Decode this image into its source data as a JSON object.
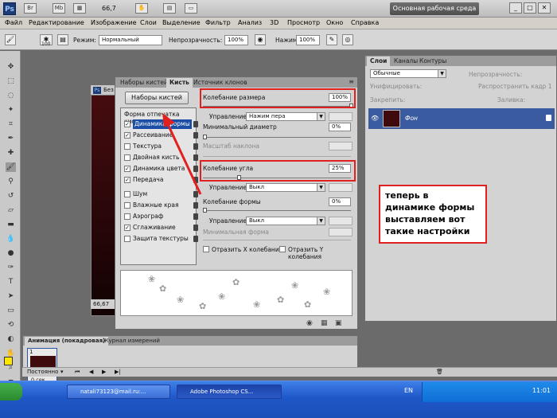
{
  "app": {
    "zoom": "66,7",
    "workspace_button": "Основная рабочая среда"
  },
  "menu": [
    "Файл",
    "Редактирование",
    "Изображение",
    "Слои",
    "Выделение",
    "Фильтр",
    "Анализ",
    "3D",
    "Просмотр",
    "Окно",
    "Справка"
  ],
  "options": {
    "brush_size": "100",
    "mode_label": "Режим:",
    "mode_value": "Нормальный",
    "opacity_label": "Непрозрачность:",
    "opacity_value": "100%",
    "pressure_label": "Нажим:",
    "pressure_value": "100%"
  },
  "document": {
    "title": "Без",
    "zoom": "66,67"
  },
  "brush_panel": {
    "tabs": [
      "Наборы кистей",
      "Кисть",
      "Источник клонов"
    ],
    "presets_button": "Наборы кистей",
    "list_header": "Форма отпечатка кисти",
    "items": [
      {
        "label": "Динамика формы",
        "checked": true
      },
      {
        "label": "Рассеивание",
        "checked": true
      },
      {
        "label": "Текстура",
        "checked": false
      },
      {
        "label": "Двойная кисть",
        "checked": false
      },
      {
        "label": "Динамика цвета",
        "checked": true
      },
      {
        "label": "Передача",
        "checked": true
      },
      {
        "label": "Шум",
        "checked": false
      },
      {
        "label": "Влажные края",
        "checked": false
      },
      {
        "label": "Аэрограф",
        "checked": false
      },
      {
        "label": "Сглаживание",
        "checked": true
      },
      {
        "label": "Защита текстуры",
        "checked": false
      }
    ],
    "size_jitter_label": "Колебание размера",
    "size_jitter_value": "100%",
    "control_label": "Управление:",
    "control1_value": "Нажим пера",
    "min_diameter_label": "Минимальный диаметр",
    "min_diameter_value": "0%",
    "tilt_scale_label": "Масштаб наклона",
    "angle_jitter_label": "Колебание угла",
    "angle_jitter_value": "25%",
    "control2_value": "Выкл",
    "roundness_jitter_label": "Колебание формы",
    "roundness_jitter_value": "0%",
    "control3_value": "Выкл",
    "min_roundness_label": "Минимальная форма",
    "flip_x_label": "Отразить X колебания",
    "flip_y_label": "Отразить Y колебания"
  },
  "layers_panel": {
    "tabs": [
      "Слои",
      "Каналы",
      "Контуры"
    ],
    "blend_mode": "Обычные",
    "opacity_label": "Непрозрачность:",
    "unify_label": "Унифицировать:",
    "propagate_label": "Распространить кадр 1",
    "lock_label": "Закрепить:",
    "fill_label": "Заливка:",
    "layer_name": "Фон"
  },
  "annotation": "теперь в динамике формы выставляем вот такие настройки",
  "animation_panel": {
    "tabs": [
      "Анимация (покадровая)",
      "Журнал измерений"
    ],
    "frame_number": "1",
    "frame_delay": "0 сек.",
    "loop": "Постоянно"
  },
  "taskbar": {
    "tasks": [
      "natali73123@mail.ru:...",
      "Adobe Photoshop CS..."
    ],
    "lang": "EN",
    "clock": "11:01"
  }
}
